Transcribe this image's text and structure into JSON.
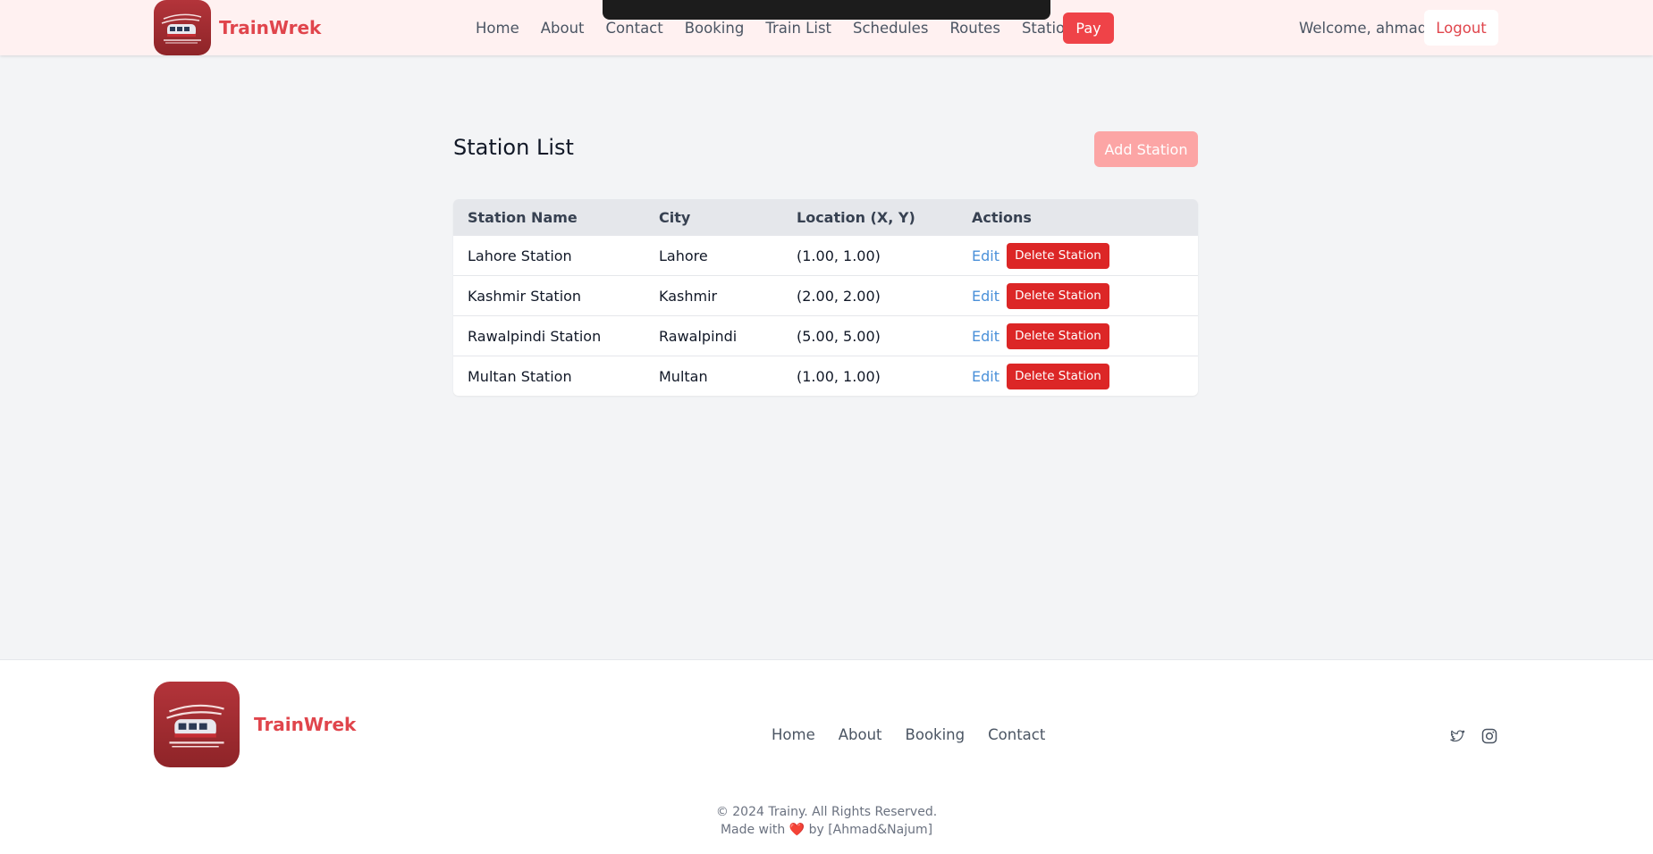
{
  "header": {
    "brand": "TrainWrek",
    "nav": [
      "Home",
      "About",
      "Contact",
      "Booking",
      "Train List",
      "Schedules",
      "Routes",
      "Stations"
    ],
    "pay_label": "Pay",
    "welcome": "Welcome, ahmad",
    "logout_label": "Logout"
  },
  "main": {
    "title": "Station List",
    "add_label": "Add Station",
    "columns": [
      "Station Name",
      "City",
      "Location (X, Y)",
      "Actions"
    ],
    "rows": [
      {
        "name": "Lahore Station",
        "city": "Lahore",
        "location": "(1.00, 1.00)",
        "edit": "Edit",
        "delete": "Delete Station"
      },
      {
        "name": "Kashmir Station",
        "city": "Kashmir",
        "location": "(2.00, 2.00)",
        "edit": "Edit",
        "delete": "Delete Station"
      },
      {
        "name": "Rawalpindi Station",
        "city": "Rawalpindi",
        "location": "(5.00, 5.00)",
        "edit": "Edit",
        "delete": "Delete Station"
      },
      {
        "name": "Multan Station",
        "city": "Multan",
        "location": "(1.00, 1.00)",
        "edit": "Edit",
        "delete": "Delete Station"
      }
    ]
  },
  "footer": {
    "brand": "TrainWrek",
    "nav": [
      "Home",
      "About",
      "Booking",
      "Contact"
    ],
    "social": [
      "twitter-icon",
      "instagram-icon"
    ],
    "copyright": "© 2024 Trainy. All Rights Reserved.",
    "made_with_prefix": "Made with",
    "made_with_suffix": "by [Ahmad&Najum]"
  },
  "colors": {
    "brand": "#e0454c",
    "header_bg": "#fff1f1",
    "delete": "#dc2626",
    "add_button": "#fca5a5",
    "link": "#4a90d9"
  }
}
